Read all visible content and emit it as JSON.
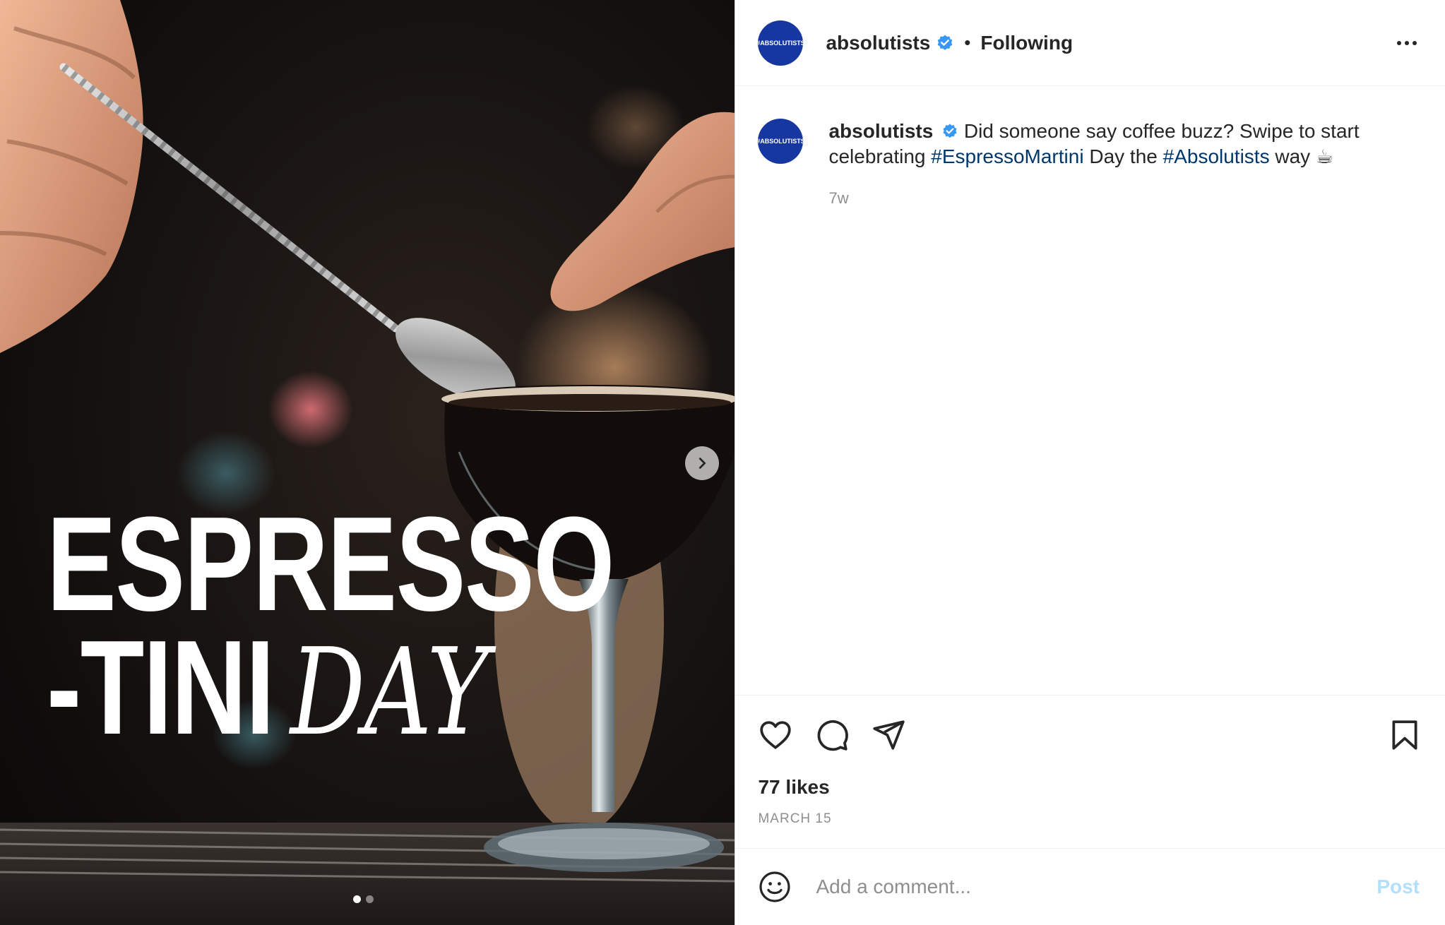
{
  "media": {
    "overlay_line1": "ESPRESSO",
    "overlay_line2": "-TINI",
    "overlay_script": "DAY",
    "slide_count": 2,
    "active_slide": 1
  },
  "header": {
    "avatar_text": "#ABSOLUTISTS",
    "username": "absolutists",
    "separator": "•",
    "following_label": "Following"
  },
  "caption": {
    "username": "absolutists",
    "text_part1": "Did someone say coffee buzz? Swipe to start celebrating ",
    "hashtag1": "#EspressoMartini",
    "text_part2": " Day the ",
    "hashtag2": "#Absolutists",
    "text_part3": " way ☕",
    "time_ago": "7w"
  },
  "stats": {
    "likes": "77 likes",
    "date": "MARCH 15"
  },
  "comment_bar": {
    "placeholder": "Add a comment...",
    "post_label": "Post"
  },
  "colors": {
    "avatar_bg": "#1637a0",
    "verified": "#3897f0",
    "hashtag": "#00376b",
    "post_disabled": "#b2dffc"
  }
}
